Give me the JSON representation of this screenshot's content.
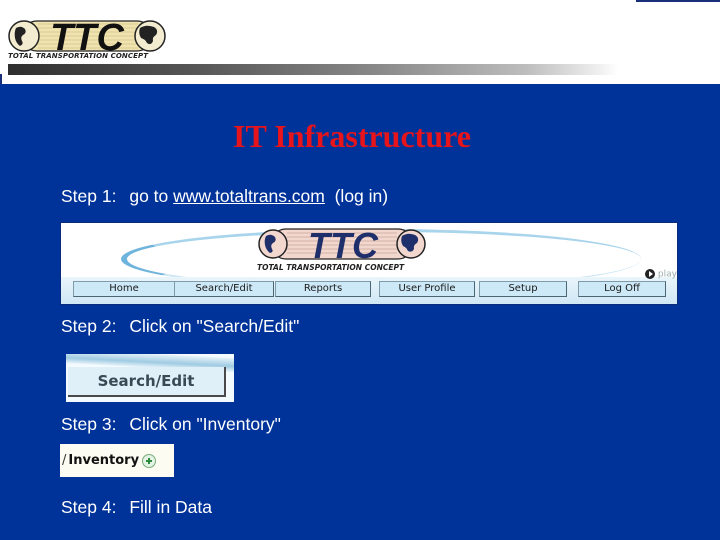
{
  "header": {
    "logo_text": "TTC",
    "tagline": "TOTAL TRANSPORTATION CONCEPT"
  },
  "title": "IT Infrastructure",
  "steps": [
    {
      "label": "Step 1:",
      "text": "go to",
      "link": "www.totaltrans.com",
      "suffix": "(log in)"
    },
    {
      "label": "Step 2:",
      "text": "Click on \"Search/Edit\""
    },
    {
      "label": "Step 3:",
      "text": "Click on \"Inventory\""
    },
    {
      "label": "Step 4:",
      "text": "Fill in Data"
    }
  ],
  "site_screenshot": {
    "logo_text": "TTC",
    "tagline": "TOTAL TRANSPORTATION CONCEPT",
    "play_label": "play",
    "nav": [
      "Home",
      "Search/Edit",
      "Reports",
      "User Profile",
      "Setup",
      "Log Off"
    ]
  },
  "search_edit_button": {
    "label": "Search/Edit"
  },
  "inventory_link": {
    "prefix": "/",
    "label": "Inventory"
  },
  "colors": {
    "background": "#003399",
    "title": "#e8141c",
    "text": "#ffffff"
  }
}
